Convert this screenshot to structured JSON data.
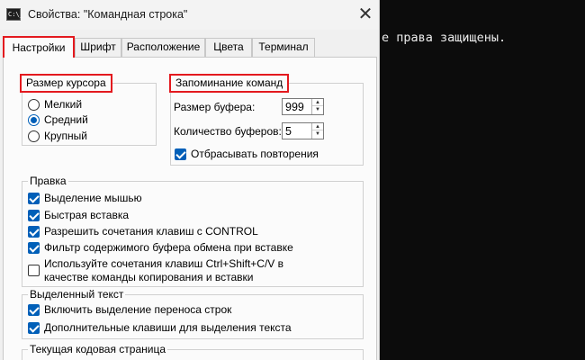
{
  "console": {
    "visible_text": "е права защищены."
  },
  "dialog": {
    "title": "Свойства: \"Командная строка\"",
    "title_icon_text": "C:\\_",
    "close_glyph": "✕"
  },
  "tabs": [
    {
      "label": "Настройки",
      "active": true
    },
    {
      "label": "Шрифт",
      "active": false
    },
    {
      "label": "Расположение",
      "active": false
    },
    {
      "label": "Цвета",
      "active": false
    },
    {
      "label": "Терминал",
      "active": false
    }
  ],
  "cursor_size": {
    "label": "Размер курсора",
    "options": [
      {
        "label": "Мелкий",
        "checked": false
      },
      {
        "label": "Средний",
        "checked": true
      },
      {
        "label": "Крупный",
        "checked": false
      }
    ]
  },
  "command_history": {
    "label": "Запоминание команд",
    "buffer_size_label": "Размер буфера:",
    "buffer_size_value": "999",
    "buffer_count_label": "Количество буферов:",
    "buffer_count_value": "5",
    "discard_duplicates_label": "Отбрасывать повторения",
    "discard_duplicates_checked": true
  },
  "edit_options": {
    "label": "Правка",
    "items": [
      {
        "label": "Выделение мышью",
        "checked": true
      },
      {
        "label": "Быстрая вставка",
        "checked": true
      },
      {
        "label": "Разрешить сочетания клавиш с CONTROL",
        "checked": true
      },
      {
        "label": "Фильтр содержимого буфера обмена при вставке",
        "checked": true
      },
      {
        "label": "Используйте сочетания клавиш Ctrl+Shift+C/V в",
        "label2": "качестве команды копирования и вставки",
        "checked": false
      }
    ]
  },
  "text_selection": {
    "label": "Выделенный текст",
    "items": [
      {
        "label": "Включить выделение переноса строк",
        "checked": true
      },
      {
        "label": "Дополнительные клавиши для выделения текста",
        "checked": true
      }
    ]
  },
  "code_page": {
    "label": "Текущая кодовая страница"
  },
  "colors": {
    "accent": "#005fb8",
    "highlight_box": "#e3191e",
    "console_bg": "#0c0c0c"
  },
  "icons": {
    "spin_up": "▲",
    "spin_down": "▼"
  }
}
